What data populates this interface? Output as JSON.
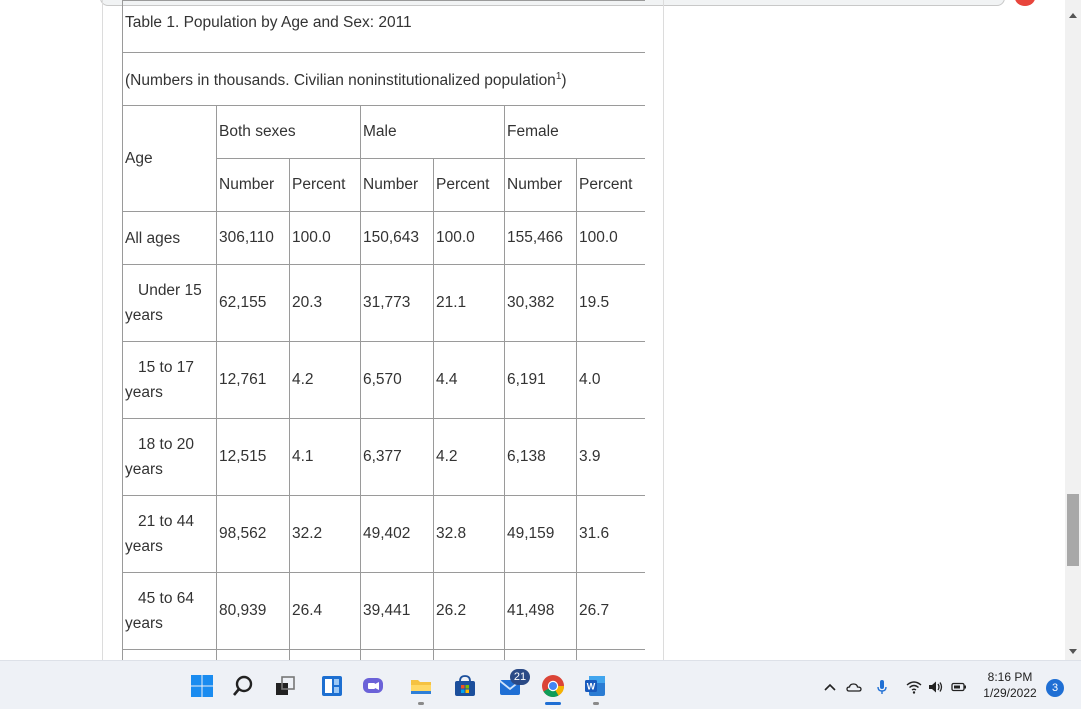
{
  "table": {
    "caption": "Table 1. Population by Age and Sex: 2011",
    "note": "(Numbers in thousands. Civilian noninstitutionalized population",
    "note_sup": "1",
    "note_close": ")",
    "age_header": "Age",
    "groups": [
      "Both sexes",
      "Male",
      "Female"
    ],
    "subheaders": [
      "Number",
      "Percent",
      "Number",
      "Percent",
      "Number",
      "Percent"
    ],
    "rows": [
      {
        "age_line1": "All ages",
        "age_line2": "",
        "cells": [
          "306,110",
          "100.0",
          "150,643",
          "100.0",
          "155,466",
          "100.0"
        ]
      },
      {
        "age_line1": "Under 15",
        "age_line2": "years",
        "cells": [
          "62,155",
          "20.3",
          "31,773",
          "21.1",
          "30,382",
          "19.5"
        ]
      },
      {
        "age_line1": "15 to 17",
        "age_line2": "years",
        "cells": [
          "12,761",
          "4.2",
          "6,570",
          "4.4",
          "6,191",
          "4.0"
        ]
      },
      {
        "age_line1": "18 to 20",
        "age_line2": "years",
        "cells": [
          "12,515",
          "4.1",
          "6,377",
          "4.2",
          "6,138",
          "3.9"
        ]
      },
      {
        "age_line1": "21 to 44",
        "age_line2": "years",
        "cells": [
          "98,562",
          "32.2",
          "49,402",
          "32.8",
          "49,159",
          "31.6"
        ]
      },
      {
        "age_line1": "45 to 64",
        "age_line2": "years",
        "cells": [
          "80,939",
          "26.4",
          "39,441",
          "26.2",
          "41,498",
          "26.7"
        ]
      }
    ]
  },
  "taskbar": {
    "icons": [
      "windows-start-icon",
      "search-icon",
      "task-view-icon",
      "widgets-icon",
      "chat-icon",
      "file-explorer-icon",
      "microsoft-store-icon",
      "mail-icon",
      "chrome-icon",
      "word-icon"
    ],
    "mail_badge": "21",
    "clock_time": "8:16 PM",
    "clock_date": "1/29/2022",
    "notification_count": "3"
  },
  "colors": {
    "taskbar_bg": "#eef1f6",
    "accent": "#1f6fd4",
    "table_border": "#9a9a9a"
  }
}
